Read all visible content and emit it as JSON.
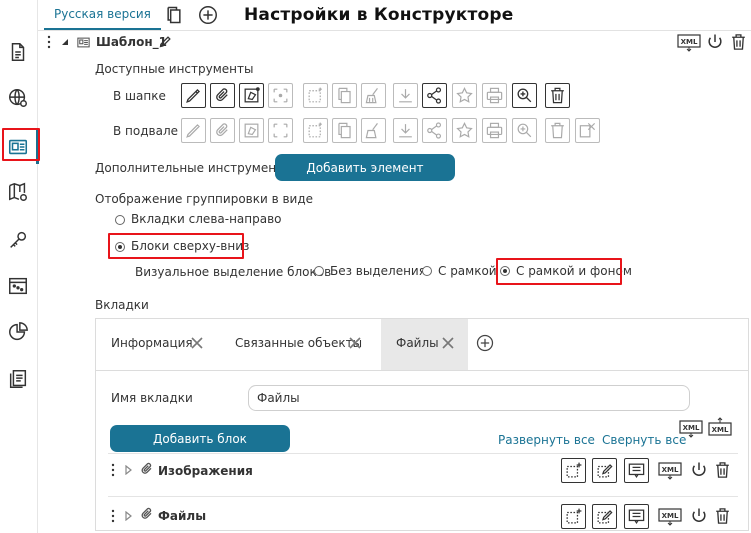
{
  "header": {
    "lang_tab": "Русская версия",
    "title": "Настройки в Конструкторе"
  },
  "template": {
    "name": "Шаблон_1"
  },
  "tools": {
    "section_label": "Доступные инструменты",
    "header_label": "В шапке",
    "footer_label": "В подвале"
  },
  "extra": {
    "label": "Дополнительные инструменты",
    "add_button": "Добавить элемент"
  },
  "grouping": {
    "label": "Отображение группировки в виде",
    "option_tabs": "Вкладки слева-направо",
    "option_blocks": "Блоки сверху-вниз",
    "selected": "blocks",
    "visual_label": "Визуальное выделение блоков",
    "visual_none": "Без выделения",
    "visual_frame": "С рамкой",
    "visual_frame_bg": "С рамкой и фоном",
    "visual_selected": "frame_bg"
  },
  "tabs_section": {
    "label": "Вкладки",
    "tabs": [
      {
        "label": "Информация"
      },
      {
        "label": "Связанные объекты"
      },
      {
        "label": "Файлы"
      }
    ],
    "active_tab": "Файлы"
  },
  "tab_editor": {
    "name_label": "Имя вкладки",
    "name_value": "Файлы",
    "add_block": "Добавить блок",
    "expand_all": "Развернуть все",
    "collapse_all": "Свернуть все"
  },
  "blocks": [
    {
      "title": "Изображения"
    },
    {
      "title": "Файлы"
    }
  ],
  "icons": {
    "xml": "XML"
  },
  "colors": {
    "accent": "#1a7394",
    "highlight": "#e8141a"
  }
}
